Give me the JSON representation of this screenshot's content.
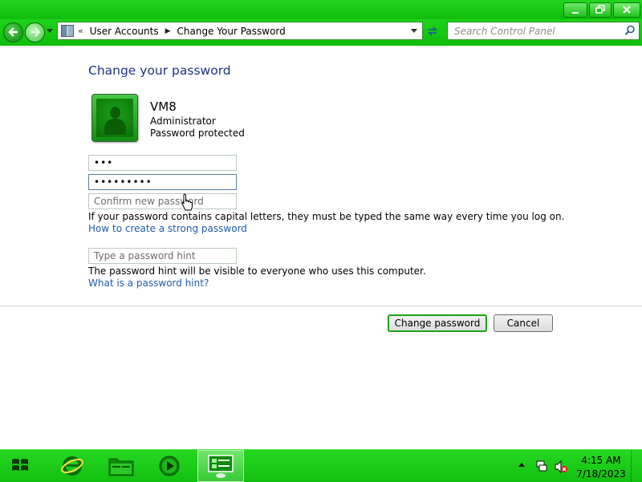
{
  "window": {
    "minimize_icon": "minimize-icon",
    "maximize_icon": "restore-icon",
    "close_icon": "close-icon"
  },
  "nav": {
    "back_icon": "back-arrow-icon",
    "forward_icon": "forward-arrow-icon",
    "breadcrumb": [
      "User Accounts",
      "Change Your Password"
    ],
    "overflow_chevron": "«",
    "search_placeholder": "Search Control Panel",
    "refresh_icon": "refresh-icon",
    "search_icon": "magnifier-icon"
  },
  "page": {
    "title": "Change your password",
    "user": {
      "name": "VM8",
      "role": "Administrator",
      "status": "Password protected"
    },
    "fields": {
      "current_password_value": "•••",
      "new_password_value": "•••••••••",
      "confirm_placeholder": "Confirm new password",
      "hint_placeholder": "Type a password hint"
    },
    "caps_note": "If your password contains capital letters, they must be typed the same way every time you log on.",
    "strong_password_link": "How to create a strong password",
    "hint_note": "The password hint will be visible to everyone who uses this computer.",
    "hint_link": "What is a password hint?",
    "buttons": {
      "change": "Change password",
      "cancel": "Cancel"
    }
  },
  "taskbar": {
    "pinned": [
      "internet-explorer-icon",
      "file-explorer-icon",
      "media-player-icon",
      "control-panel-icon"
    ],
    "clock": {
      "time": "4:15 AM",
      "date": "7/18/2023"
    }
  },
  "colors": {
    "theme_green": "#10bd0d",
    "title_blue": "#1e3287",
    "link_blue": "#1e5ca8"
  }
}
